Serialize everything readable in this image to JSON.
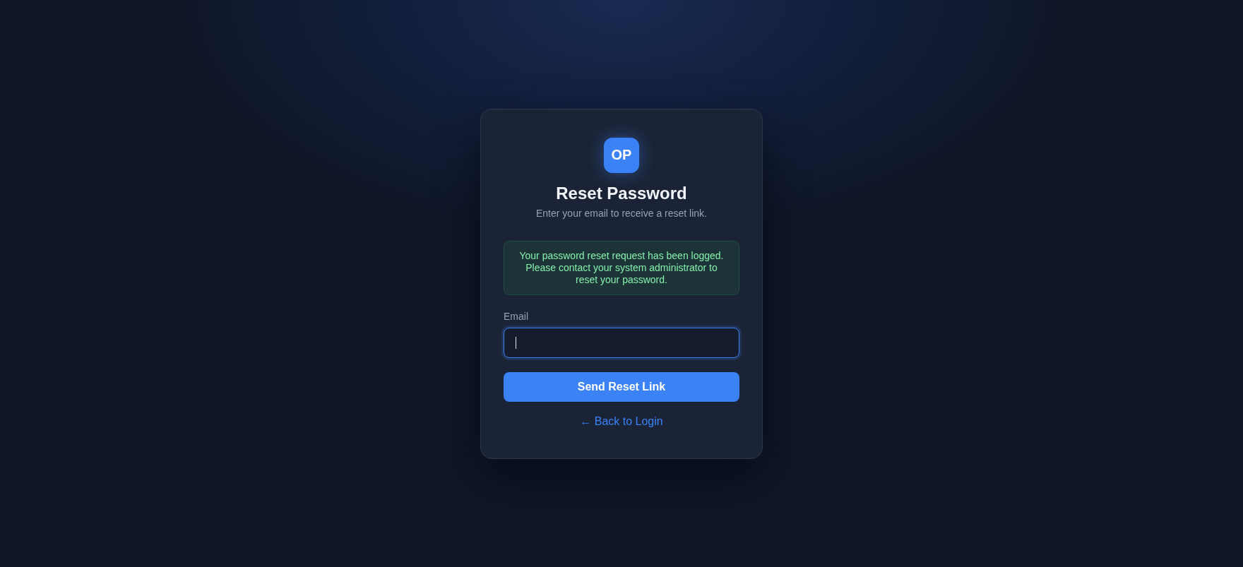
{
  "logo": {
    "text": "OP"
  },
  "header": {
    "title": "Reset Password",
    "subtitle": "Enter your email to receive a reset link."
  },
  "alert": {
    "kind": "success",
    "message": "Your password reset request has been logged. Please contact your system administrator to reset your password."
  },
  "email_field": {
    "label": "Email",
    "focused": true
  },
  "submit_button": {
    "label": "Send Reset Link"
  },
  "back_link": {
    "label": "← Back to Login"
  }
}
